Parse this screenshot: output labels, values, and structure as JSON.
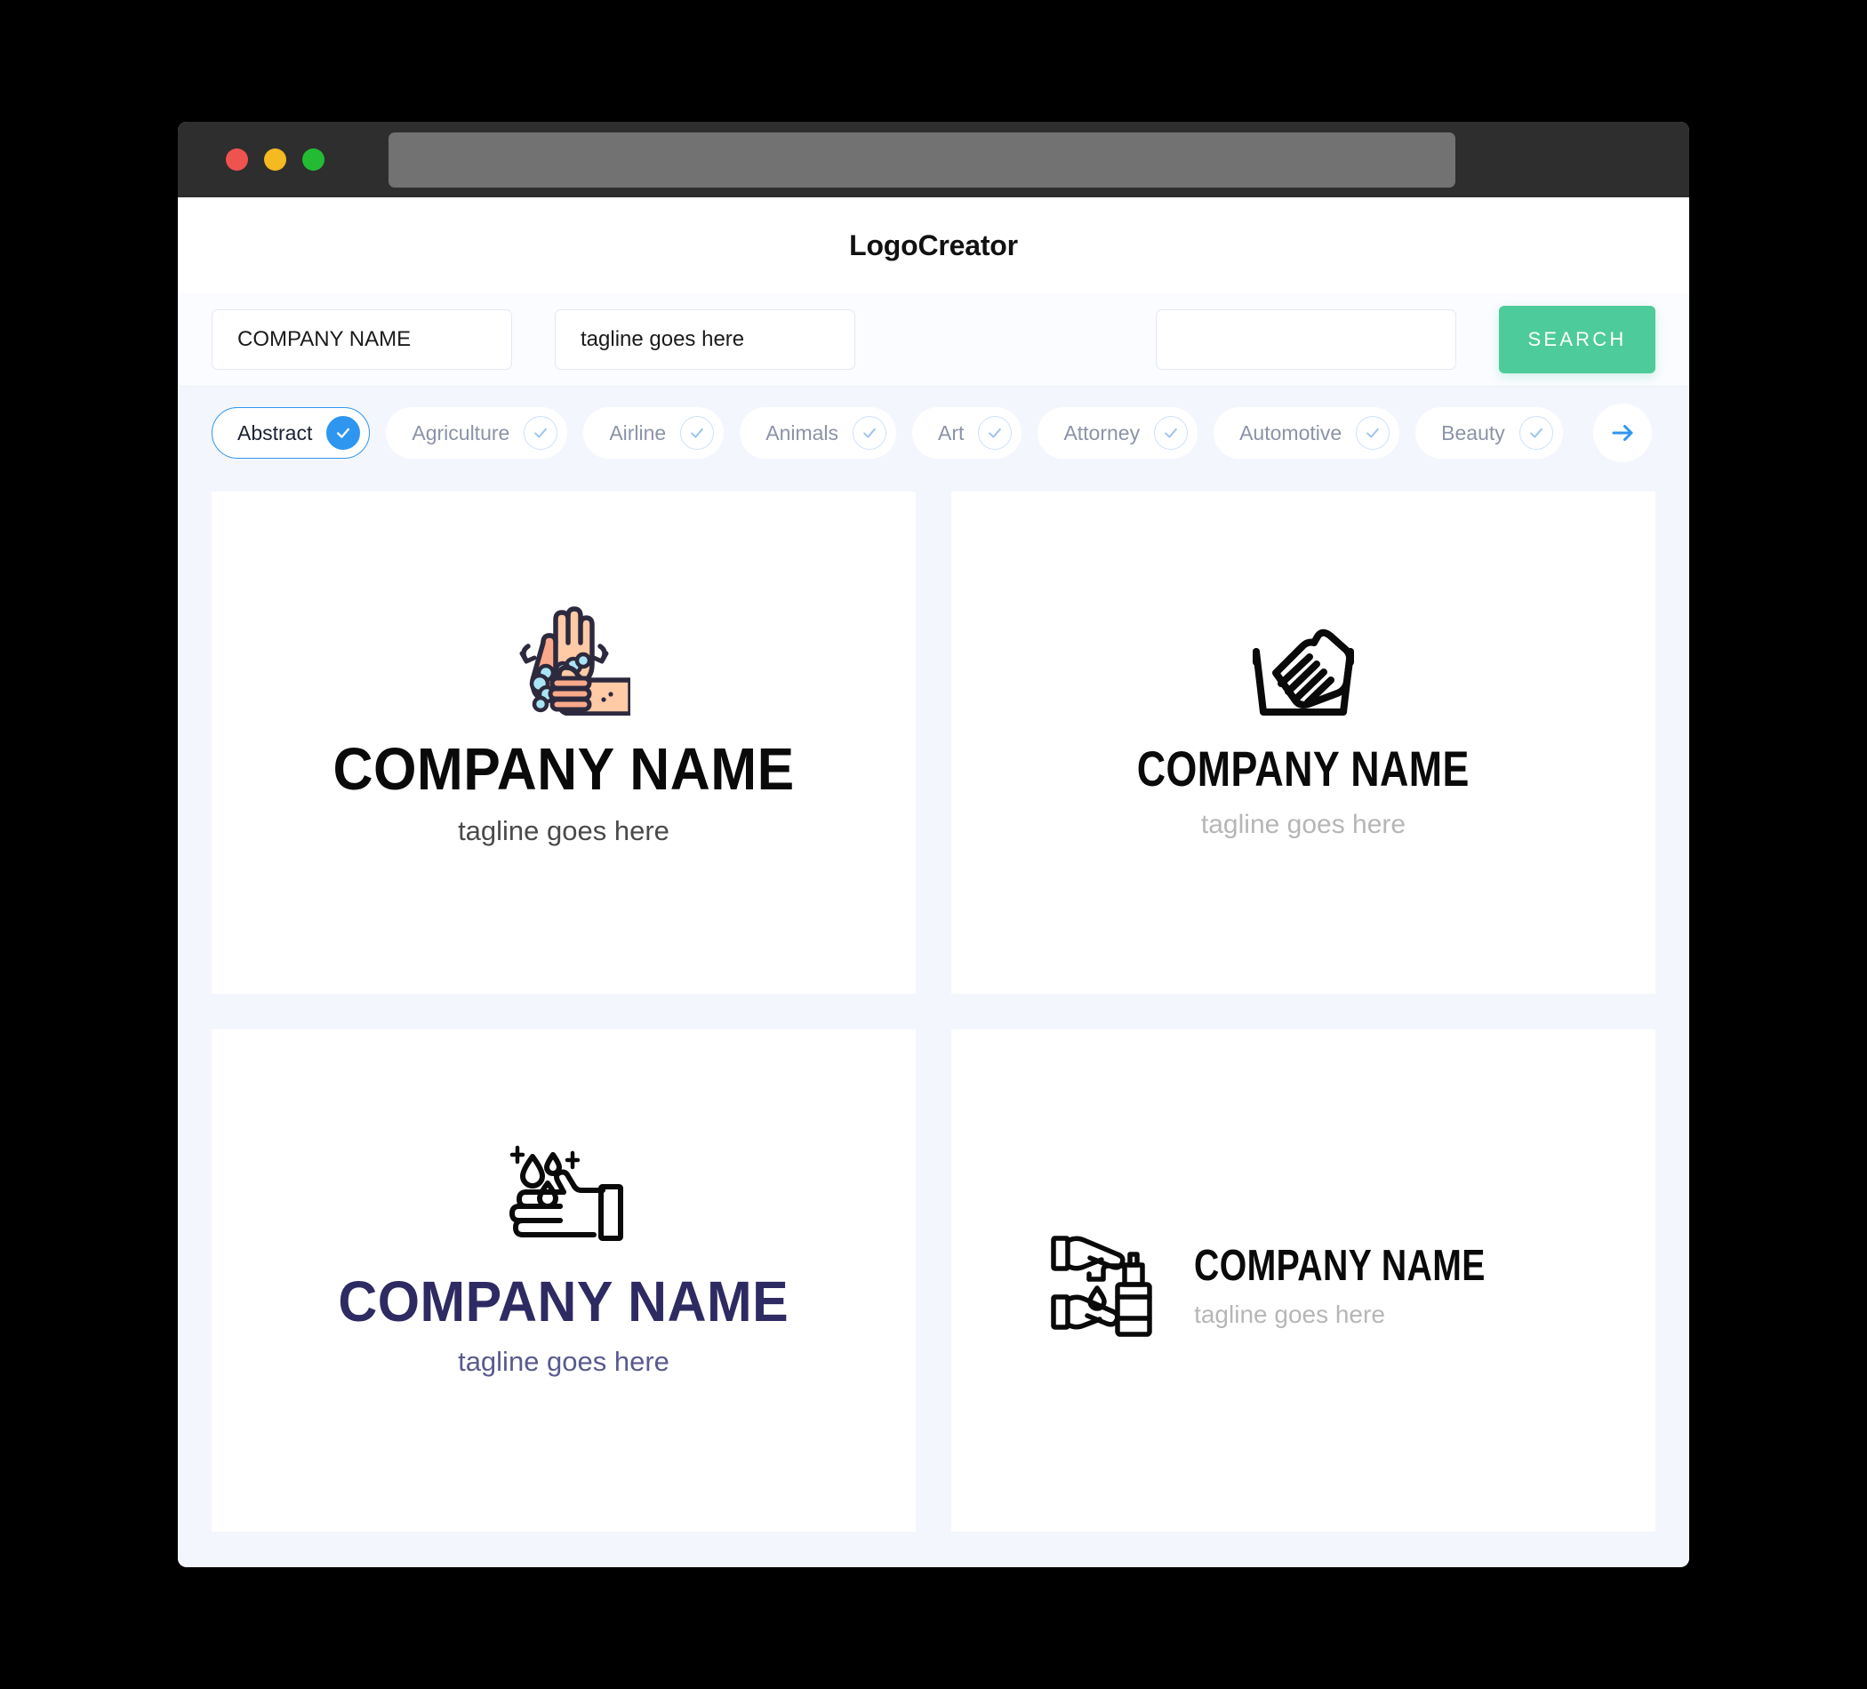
{
  "window": {
    "traffic_lights": [
      {
        "name": "close",
        "color": "#ef5350"
      },
      {
        "name": "minimize",
        "color": "#f5b921"
      },
      {
        "name": "maximize",
        "color": "#22bb33"
      }
    ],
    "address_bar_value": ""
  },
  "header": {
    "app_title": "LogoCreator"
  },
  "search": {
    "company_value": "COMPANY NAME",
    "company_placeholder": "COMPANY NAME",
    "tagline_value": "tagline goes here",
    "tagline_placeholder": "tagline goes here",
    "keyword_value": "",
    "keyword_placeholder": "",
    "search_label": "SEARCH",
    "search_button_color": "#4ecb9a"
  },
  "categories": {
    "active": "Abstract",
    "accent_color": "#2f96f0",
    "next_arrow_icon": "arrow-right-icon",
    "items": [
      {
        "label": "Abstract",
        "selected": true
      },
      {
        "label": "Agriculture",
        "selected": false
      },
      {
        "label": "Airline",
        "selected": false
      },
      {
        "label": "Animals",
        "selected": false
      },
      {
        "label": "Art",
        "selected": false
      },
      {
        "label": "Attorney",
        "selected": false
      },
      {
        "label": "Automotive",
        "selected": false
      },
      {
        "label": "Beauty",
        "selected": false
      }
    ]
  },
  "results": [
    {
      "icon": "washing-hands-color-icon",
      "layout": "stacked",
      "company_name": "COMPANY NAME",
      "tagline": "tagline goes here",
      "name_color": "#0a0a0a",
      "tagline_color": "#4a4a4a"
    },
    {
      "icon": "hands-in-basin-outline-icon",
      "layout": "stacked",
      "company_name": "COMPANY NAME",
      "tagline": "tagline goes here",
      "name_color": "#0a0a0a",
      "tagline_color": "#b6b6b6"
    },
    {
      "icon": "hand-water-droplets-icon",
      "layout": "stacked",
      "company_name": "COMPANY NAME",
      "tagline": "tagline goes here",
      "name_color": "#2e2a62",
      "tagline_color": "#5a5a90"
    },
    {
      "icon": "hands-soap-dispenser-icon",
      "layout": "horizontal",
      "company_name": "COMPANY NAME",
      "tagline": "tagline goes here",
      "name_color": "#0a0a0a",
      "tagline_color": "#b6b6b6"
    }
  ],
  "theme": {
    "page_background": "#f4f6fd",
    "card_background": "#ffffff",
    "titlebar_background": "#2e2e2e",
    "skin_light": "#ffcaa6",
    "skin_mid": "#fba98a",
    "outline_navy": "#2d2a3e",
    "soap_blue": "#a9e4f5"
  }
}
